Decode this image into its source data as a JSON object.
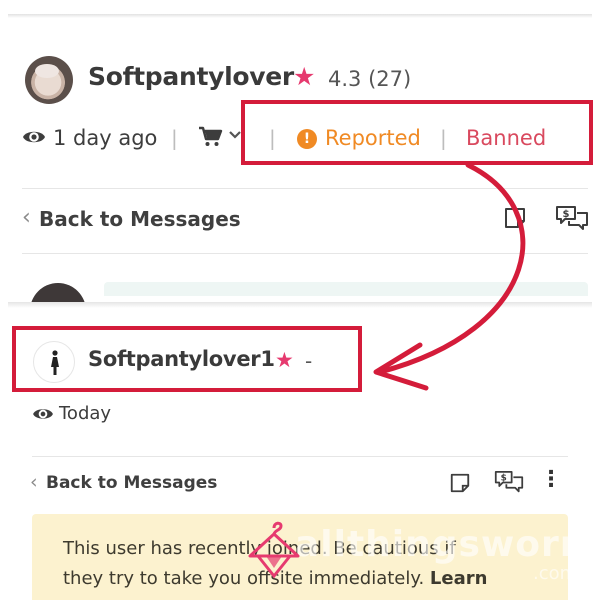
{
  "top_profile": {
    "username": "Softpantylover",
    "rating": "4.3",
    "review_count": "(27)",
    "last_seen": "1 day ago",
    "status_reported": "Reported",
    "status_banned": "Banned",
    "separator": "|",
    "back_label": "Back to Messages"
  },
  "bottom_profile": {
    "username": "Softpantylover1",
    "rating": "-",
    "last_seen": "Today",
    "back_label": "Back to Messages"
  },
  "banner": {
    "text_line1": "This user has recently joined. Be cautious if",
    "text_line2": "they try to take you offsite immediately. ",
    "learn_label": "Learn"
  },
  "watermark": {
    "text": "allthingsworn",
    "suffix": ".com"
  },
  "icons": {
    "star": "★",
    "warning": "!",
    "back_chevron": "‹",
    "kebab": "⋮",
    "cart_chevron": "⌄"
  },
  "colors": {
    "highlight_red": "#d41c3a",
    "star_pink": "#e63a6f",
    "reported_orange": "#f08a24",
    "banned_red": "#d9495e",
    "banner_yellow": "#fcf2cf"
  }
}
